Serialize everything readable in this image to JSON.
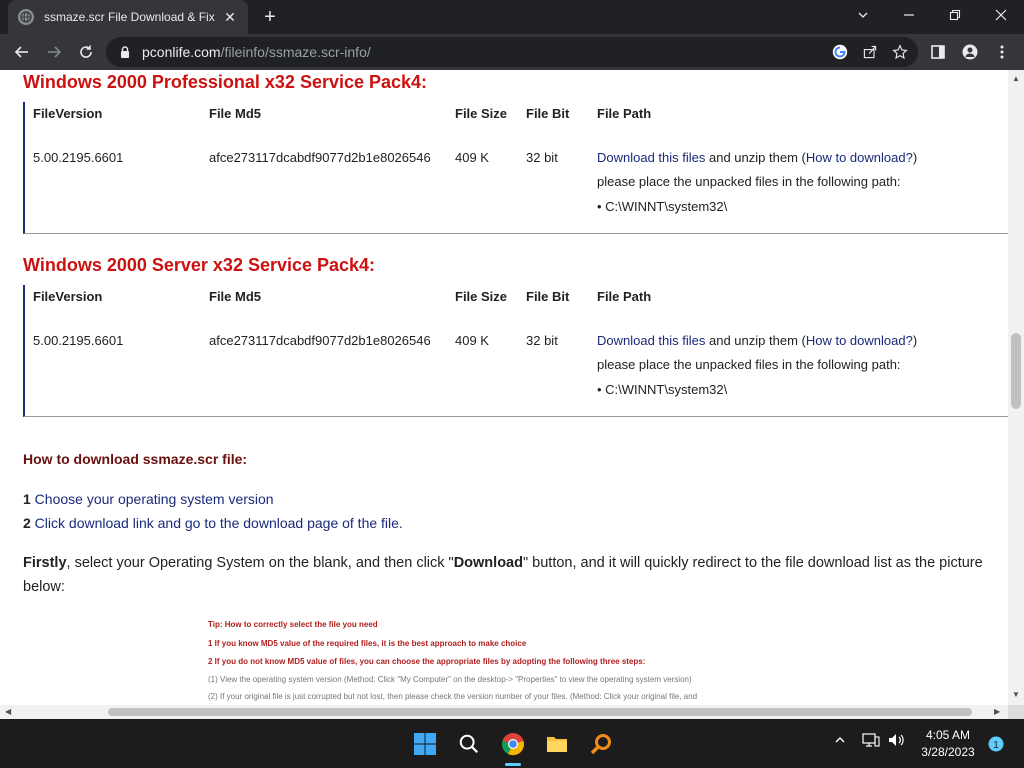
{
  "browser": {
    "tab_title": "ssmaze.scr File Download & Fix F",
    "url_host": "pconlife.com",
    "url_path": "/fileinfo/ssmaze.scr-info/"
  },
  "page": {
    "sections": [
      {
        "title": "Windows 2000 Professional x32 Service Pack4:",
        "headers": [
          "FileVersion",
          "File Md5",
          "File Size",
          "File Bit",
          "File Path"
        ],
        "file_version": "5.00.2195.6601",
        "md5": "afce273117dcabdf9077d2b1e8026546",
        "size": "409 K",
        "bit": "32 bit",
        "download_link": "Download this files",
        "unzip_text": " and unzip them (",
        "howto_link": "How to download?",
        "close_paren": ")",
        "place_text": "please place the unpacked files in the following path:",
        "path": "• C:\\WINNT\\system32\\"
      },
      {
        "title": "Windows 2000 Server x32 Service Pack4:",
        "headers": [
          "FileVersion",
          "File Md5",
          "File Size",
          "File Bit",
          "File Path"
        ],
        "file_version": "5.00.2195.6601",
        "md5": "afce273117dcabdf9077d2b1e8026546",
        "size": "409 K",
        "bit": "32 bit",
        "download_link": "Download this files",
        "unzip_text": " and unzip them (",
        "howto_link": "How to download?",
        "close_paren": ")",
        "place_text": "please place the unpacked files in the following path:",
        "path": "• C:\\WINNT\\system32\\"
      }
    ],
    "howto_title": "How to download ssmaze.scr file:",
    "steps": [
      {
        "num": "1",
        "text": " Choose your operating system version"
      },
      {
        "num": "2",
        "text": " Click download link and go to the download page of the file."
      }
    ],
    "firstly_bold": "Firstly",
    "firstly_text": ", select your Operating System on the blank, and then click \"",
    "download_bold": "Download",
    "firstly_rest": "\" button, and it will quickly redirect to the file download list as the picture below:",
    "tip_lines": [
      "Tip: How to correctly select the file you need",
      "1 If you know MD5 value of the required files, it is the best approach to make choice",
      "2 If you do not know MD5 value of files, you can choose the appropriate files by adopting the following three steps:",
      " (1) View the operating system version  (Method: Click \"My Computer\" on the desktop-> \"Properties\" to view the operating system version)",
      " (2) If your original file is just corrupted but not lost, then please check the version number of your files. (Method: Click your original file, and"
    ]
  },
  "taskbar": {
    "time": "4:05 AM",
    "date": "3/28/2023",
    "notification_count": "1"
  },
  "colors": {
    "section_title": "#cc1111",
    "link": "#1a2a7a",
    "howto_title": "#6a0f0f"
  }
}
